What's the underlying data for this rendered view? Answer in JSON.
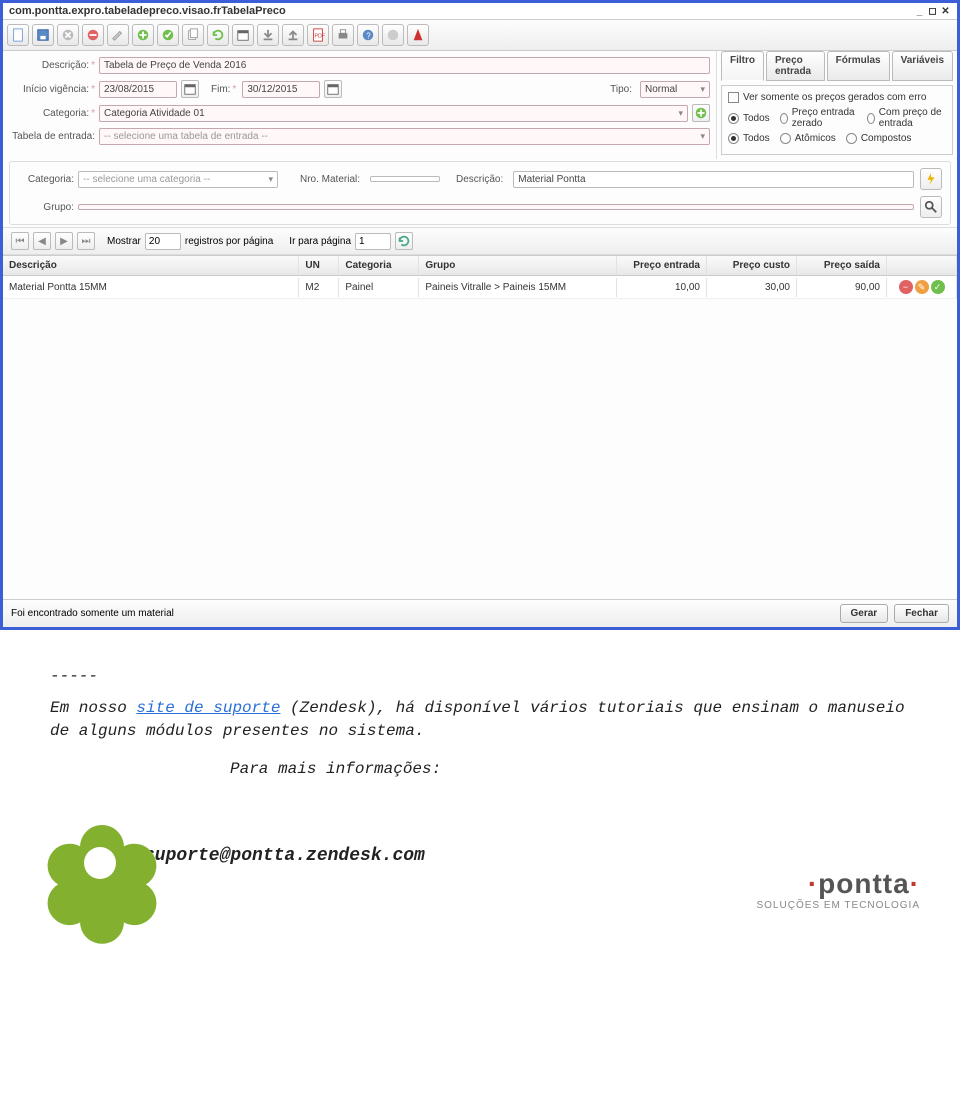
{
  "window": {
    "title": "com.pontta.expro.tabeladepreco.visao.frTabelaPreco"
  },
  "toolbar_icons": [
    "doc",
    "save",
    "close",
    "deny",
    "edit",
    "add",
    "ok",
    "copy",
    "refresh",
    "calendar",
    "down",
    "up",
    "pdf",
    "print",
    "help",
    "chart",
    "user"
  ],
  "form": {
    "descricao_label": "Descrição:",
    "descricao_value": "Tabela de Preço de Venda 2016",
    "inicio_label": "Início vigência:",
    "inicio_value": "23/08/2015",
    "fim_label": "Fim:",
    "fim_value": "30/12/2015",
    "tipo_label": "Tipo:",
    "tipo_value": "Normal",
    "categoria_label": "Categoria:",
    "categoria_value": "Categoria Atividade 01",
    "tabela_label": "Tabela de entrada:",
    "tabela_placeholder": "-- selecione uma tabela de entrada --"
  },
  "right_tabs": [
    "Filtro",
    "Preço entrada",
    "Fórmulas",
    "Variáveis"
  ],
  "filter_panel": {
    "err_label": "Ver somente os preços gerados com erro",
    "row1": [
      "Todos",
      "Preço entrada zerado",
      "Com preço de entrada"
    ],
    "row2": [
      "Todos",
      "Atômicos",
      "Compostos"
    ]
  },
  "search": {
    "categoria_label": "Categoria:",
    "categoria_placeholder": "-- selecione uma categoria --",
    "nro_label": "Nro. Material:",
    "nro_value": "",
    "descricao_label": "Descrição:",
    "descricao_value": "Material Pontta",
    "grupo_label": "Grupo:",
    "grupo_value": ""
  },
  "pager": {
    "mostrar_label": "Mostrar",
    "mostrar_value": "20",
    "regpp_label": "registros por página",
    "irpara_label": "Ir para página",
    "irpara_value": "1"
  },
  "grid": {
    "headers": [
      "Descrição",
      "UN",
      "Categoria",
      "Grupo",
      "Preço entrada",
      "Preço custo",
      "Preço saída",
      ""
    ],
    "rows": [
      {
        "descricao": "Material Pontta 15MM",
        "un": "M2",
        "categoria": "Painel",
        "grupo": "Paineis Vitralle > Paineis 15MM",
        "preco_entrada": "10,00",
        "preco_custo": "30,00",
        "preco_saida": "90,00"
      }
    ]
  },
  "footer": {
    "status": "Foi encontrado somente um material",
    "gerar": "Gerar",
    "fechar": "Fechar"
  },
  "article": {
    "sep": "-----",
    "t1": "Em nosso ",
    "link": "site de suporte",
    "t2": " (Zendesk), há disponível vários tutoriais que ensinam o manuseio de alguns módulos presentes no sistema.",
    "more": "Para mais informações:",
    "email": "suporte@pontta.zendesk.com"
  },
  "brand": {
    "name": "pontta",
    "sub": "SOLUÇÕES EM TECNOLOGIA"
  }
}
